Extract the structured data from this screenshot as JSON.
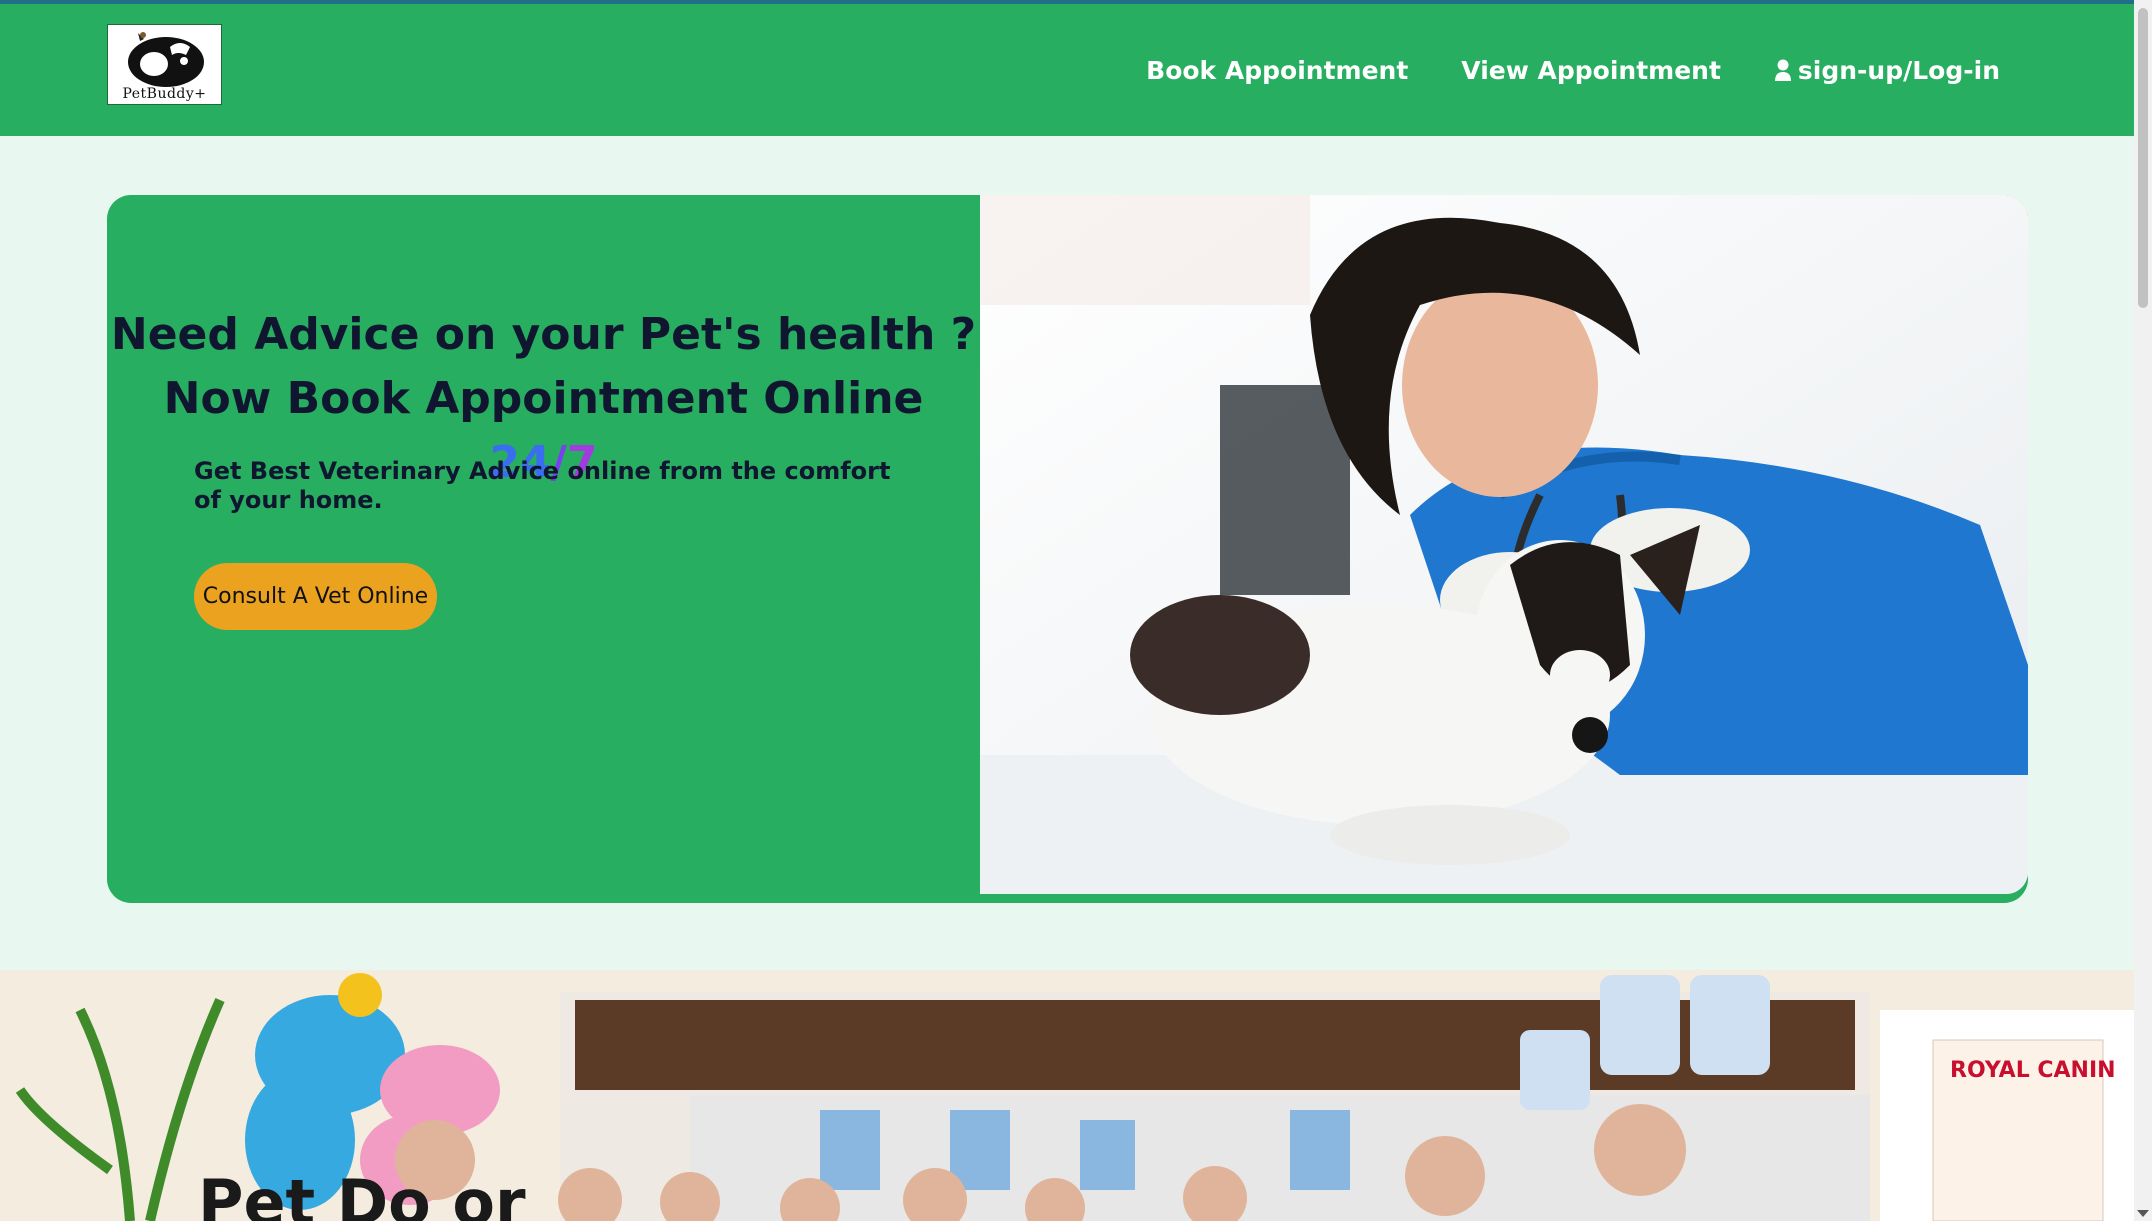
{
  "brand": {
    "logo_text": "PetBuddy+"
  },
  "nav": {
    "book": "Book Appointment",
    "view": "View Appointment",
    "auth": "sign-up/Log-in"
  },
  "hero": {
    "line1": "Need Advice on your Pet's health ?",
    "line2_prefix": "Now Book Appointment Online ",
    "line2_num1": "24",
    "line2_slash": "/",
    "line2_num2": "7",
    "subtext": "Get Best Veterinary Advice online from the comfort of your home.",
    "cta": "Consult A Vet Online"
  },
  "team": {
    "sign_text": "Pet Do   or",
    "royal_canin": "ROYAL CANIN"
  },
  "colors": {
    "navbar": "#27ae60",
    "hero": "#27ae60",
    "page_bg": "#e8f7ef",
    "cta": "#eba21f",
    "heading": "#10162f",
    "accent_24": "#3a6df0",
    "accent_7": "#a23be0"
  }
}
